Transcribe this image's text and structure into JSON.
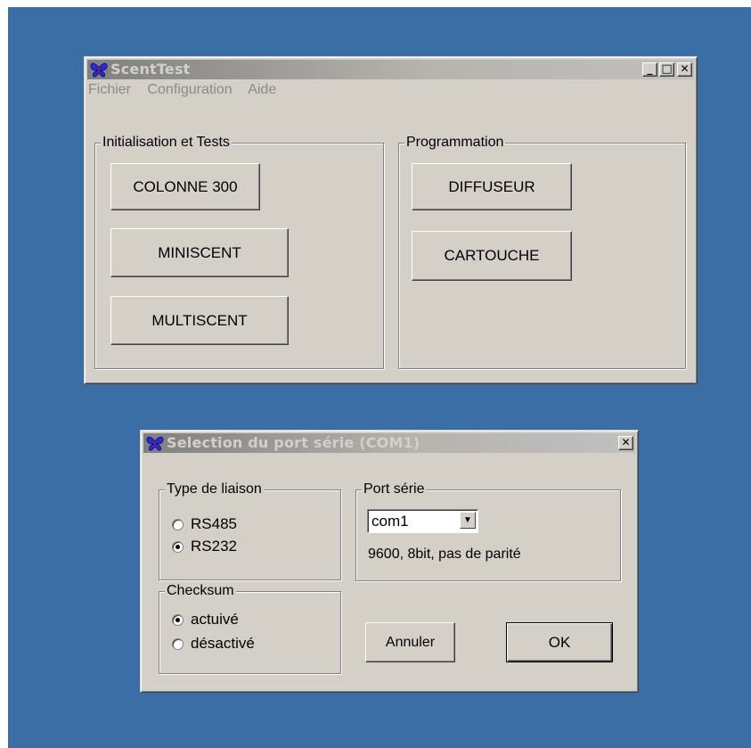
{
  "main_window": {
    "title": "ScentTest",
    "minimize_glyph": "_",
    "maximize_glyph": "□",
    "close_glyph": "✕",
    "menu": [
      "Fichier",
      "Configuration",
      "Aide"
    ],
    "groups": {
      "init_tests": {
        "label": "Initialisation et Tests",
        "buttons": [
          "COLONNE 300",
          "MINISCENT",
          "MULTISCENT"
        ]
      },
      "programmation": {
        "label": "Programmation",
        "buttons": [
          "DIFFUSEUR",
          "CARTOUCHE"
        ]
      }
    }
  },
  "dialog": {
    "title": "Selection du port série (COM1)",
    "close_glyph": "✕",
    "type_liaison": {
      "label": "Type de liaison",
      "options": [
        {
          "label": "RS485",
          "checked": false
        },
        {
          "label": "RS232",
          "checked": true
        }
      ]
    },
    "checksum": {
      "label": "Checksum",
      "options": [
        {
          "label": "actuivé",
          "checked": true
        },
        {
          "label": "désactivé",
          "checked": false
        }
      ]
    },
    "port_serie": {
      "label": "Port série",
      "selected": "com1",
      "arrow_glyph": "▼",
      "info": "9600, 8bit, pas de parité"
    },
    "cancel_label": "Annuler",
    "ok_label": "OK"
  },
  "colors": {
    "desktop": "#3a6ea5",
    "window_face": "#d4d0c8",
    "inactive_title": "#808080",
    "icon_blue": "#2b2bd6"
  }
}
